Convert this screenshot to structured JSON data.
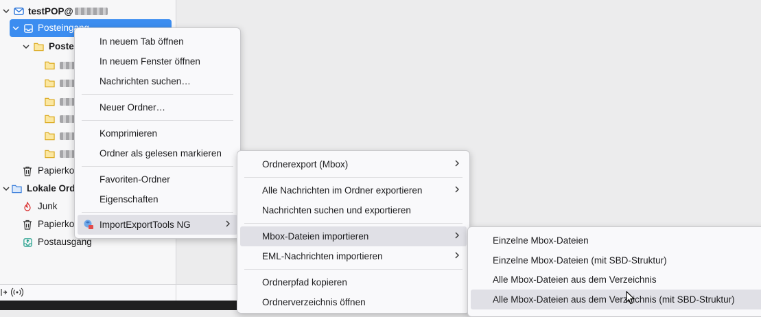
{
  "sidebar": {
    "account": {
      "name": "testPOP@",
      "name_blurred": true
    },
    "inbox": {
      "label": "Posteingang"
    },
    "subfolder": {
      "label": "Posteingang"
    },
    "hidden_folders_count": 6,
    "trash": {
      "label": "Papierkorb"
    },
    "local_folders": {
      "label": "Lokale Ordner"
    },
    "junk": {
      "label": "Junk"
    },
    "local_trash": {
      "label": "Papierkorb"
    },
    "outbox": {
      "label": "Postausgang"
    }
  },
  "status_icons": [
    "collapse-pane-icon",
    "online-status-icon"
  ],
  "context_menu": {
    "items": [
      {
        "label": "In neuem Tab öffnen",
        "access": "T"
      },
      {
        "label": "In neuem Fenster öffnen",
        "access": "ö"
      },
      {
        "label": "Nachrichten suchen…",
        "access": "s"
      },
      {
        "separator": true
      },
      {
        "label": "Neuer Ordner…",
        "access": "N"
      },
      {
        "separator": true
      },
      {
        "label": "Komprimieren",
        "access": "K"
      },
      {
        "label": "Ordner als gelesen markieren",
        "access": "d"
      },
      {
        "separator": true
      },
      {
        "label": "Favoriten-Ordner",
        "access": "F"
      },
      {
        "label": "Eigenschaften",
        "access": "E"
      },
      {
        "separator": true
      },
      {
        "label": "ImportExportTools NG",
        "submenu": true,
        "highlighted": true
      }
    ]
  },
  "importexport_menu": {
    "items": [
      {
        "label": "Ordnerexport (Mbox)",
        "submenu": true
      },
      {
        "separator": true
      },
      {
        "label": "Alle Nachrichten im Ordner exportieren",
        "submenu": true
      },
      {
        "label": "Nachrichten suchen und exportieren"
      },
      {
        "separator": true
      },
      {
        "label": "Mbox-Dateien importieren",
        "submenu": true,
        "highlighted": true
      },
      {
        "label": "EML-Nachrichten importieren",
        "submenu": true
      },
      {
        "separator": true
      },
      {
        "label": "Ordnerpfad kopieren"
      },
      {
        "label": "Ordnerverzeichnis öffnen"
      }
    ]
  },
  "mbox_menu": {
    "items": [
      {
        "label": "Einzelne Mbox-Dateien"
      },
      {
        "label": "Einzelne Mbox-Dateien (mit SBD-Struktur)"
      },
      {
        "label": "Alle Mbox-Dateien aus dem Verzeichnis"
      },
      {
        "label": "Alle Mbox-Dateien aus dem Verzeichnis (mit SBD-Struktur)",
        "highlighted": true
      }
    ]
  },
  "colors": {
    "selection": "#3c8df0",
    "menu_bg": "#f9f9fb",
    "menu_hover": "#e0e0e6",
    "folder": "#f2c744"
  }
}
